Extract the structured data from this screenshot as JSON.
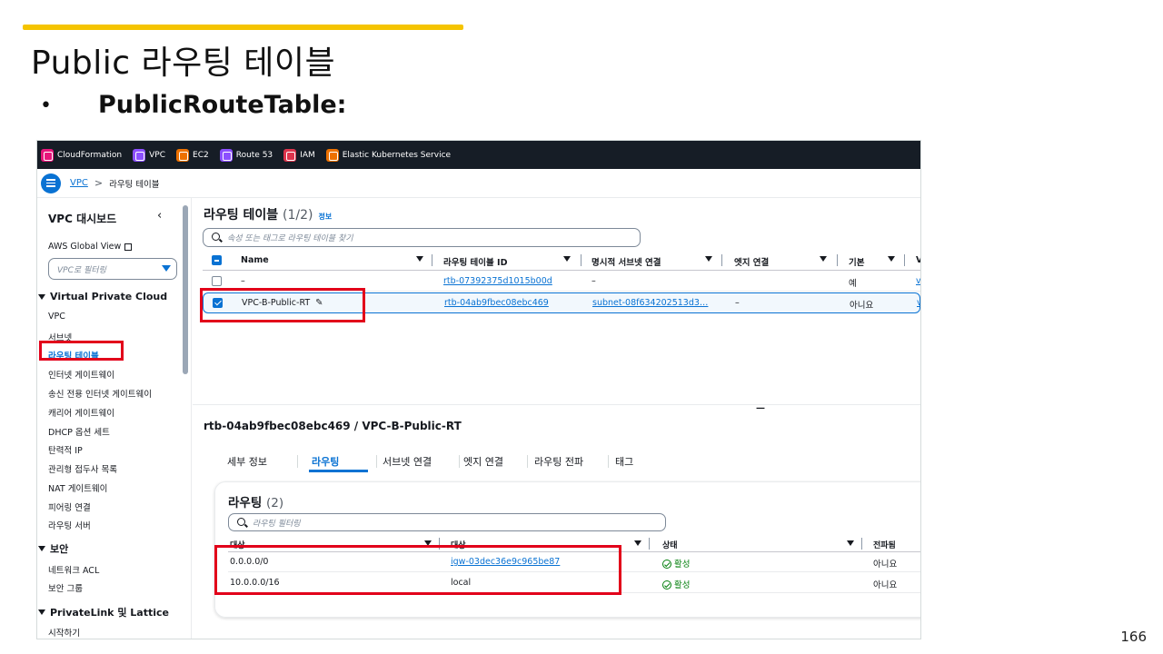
{
  "slide": {
    "title": "Public 라우팅 테이블",
    "bullet": "•",
    "bullet_text": "PublicRouteTable:",
    "page_number": "166",
    "accent_color": "#f5c400",
    "highlight_color": "#e2001a"
  },
  "services": [
    {
      "label": "CloudFormation",
      "icon": "cloudformation-icon",
      "color": "#e7157b"
    },
    {
      "label": "VPC",
      "icon": "vpc-icon",
      "color": "#8c4fff"
    },
    {
      "label": "EC2",
      "icon": "ec2-icon",
      "color": "#ed7100"
    },
    {
      "label": "Route 53",
      "icon": "route53-icon",
      "color": "#8c4fff"
    },
    {
      "label": "IAM",
      "icon": "iam-icon",
      "color": "#dd344c"
    },
    {
      "label": "Elastic Kubernetes Service",
      "icon": "eks-icon",
      "color": "#ed7100"
    }
  ],
  "breadcrumb": {
    "root": "VPC",
    "sep": ">",
    "current": "라우팅 테이블"
  },
  "sidebar": {
    "title": "VPC 대시보드",
    "collapse": "‹",
    "global_view": "AWS Global View",
    "filter_placeholder": "VPC로 필터링",
    "sections": [
      {
        "label": "Virtual Private Cloud",
        "items": [
          "VPC",
          "서브넷",
          "라우팅 테이블",
          "인터넷 게이트웨이",
          "송신 전용 인터넷 게이트웨이",
          "캐리어 게이트웨이",
          "DHCP 옵션 세트",
          "탄력적 IP",
          "관리형 접두사 목록",
          "NAT 게이트웨이",
          "피어링 연결",
          "라우팅 서버"
        ]
      },
      {
        "label": "보안",
        "items": [
          "네트워크 ACL",
          "보안 그룹"
        ]
      },
      {
        "label": "PrivateLink 및 Lattice",
        "items": [
          "시작하기"
        ]
      }
    ],
    "active_item": "라우팅 테이블"
  },
  "route_tables": {
    "title": "라우팅 테이블",
    "count": "(1/2)",
    "info": "정보",
    "search_placeholder": "속성 또는 태그로 라우팅 테이블 찾기",
    "columns": [
      "Name",
      "라우팅 테이블 ID",
      "명시적 서브넷 연결",
      "엣지 연결",
      "기본",
      "V"
    ],
    "rows": [
      {
        "name": "–",
        "id": "rtb-07392375d1015b00d",
        "subnet": "–",
        "edge": "",
        "main": "예",
        "vpc": "vp",
        "selected": false
      },
      {
        "name": "VPC-B-Public-RT",
        "id": "rtb-04ab9fbec08ebc469",
        "subnet": "subnet-08f634202513d3…",
        "edge": "–",
        "main": "아니요",
        "vpc": "vp",
        "selected": true
      }
    ]
  },
  "drag_handle": "—",
  "detail": {
    "title": "rtb-04ab9fbec08ebc469 / VPC-B-Public-RT",
    "tabs": [
      "세부 정보",
      "라우팅",
      "서브넷 연결",
      "엣지 연결",
      "라우팅 전파",
      "태그"
    ],
    "active_tab": "라우팅",
    "routes_title": "라우팅",
    "routes_count": "(2)",
    "filter_placeholder": "라우팅 필터링",
    "columns": [
      "대상",
      "대상",
      "상태",
      "전파됨"
    ],
    "rows": [
      {
        "destination": "0.0.0.0/0",
        "target": "igw-03dec36e9c965be87",
        "target_link": true,
        "status": "활성",
        "propagated": "아니요"
      },
      {
        "destination": "10.0.0.0/16",
        "target": "local",
        "target_link": false,
        "status": "활성",
        "propagated": "아니요"
      }
    ]
  }
}
